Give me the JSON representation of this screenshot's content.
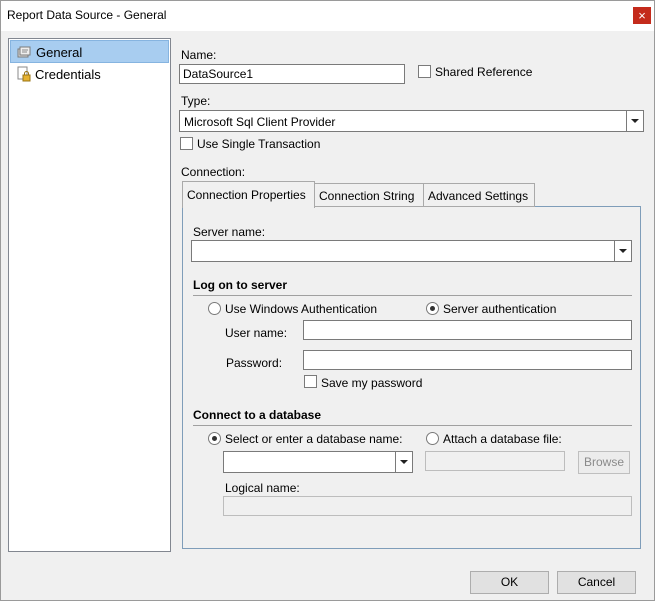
{
  "window": {
    "title": "Report Data Source - General",
    "close_glyph": "×"
  },
  "nav": {
    "items": [
      {
        "label": "General",
        "icon": "general-settings-icon",
        "selected": true
      },
      {
        "label": "Credentials",
        "icon": "credentials-lock-icon",
        "selected": false
      }
    ]
  },
  "general": {
    "name_label": "Name:",
    "name_value": "DataSource1",
    "shared_reference_label": "Shared Reference",
    "shared_reference_checked": false,
    "type_label": "Type:",
    "type_value": "Microsoft Sql Client Provider",
    "single_transaction_label": "Use Single Transaction",
    "single_transaction_checked": false,
    "connection_label": "Connection:"
  },
  "tabs": [
    {
      "label": "Connection Properties",
      "active": true
    },
    {
      "label": "Connection String",
      "active": false
    },
    {
      "label": "Advanced Settings",
      "active": false
    }
  ],
  "connection": {
    "server_name_label": "Server name:",
    "server_name_value": "",
    "logon_title": "Log on to server",
    "windows_auth_label": "Use Windows Authentication",
    "server_auth_label": "Server authentication",
    "auth_mode": "server",
    "username_label": "User name:",
    "username_value": "",
    "password_label": "Password:",
    "password_value": "",
    "save_password_label": "Save my password",
    "save_password_checked": false,
    "database_title": "Connect to a database",
    "select_db_label": "Select or enter a database name:",
    "attach_db_label": "Attach a database file:",
    "db_mode": "select",
    "database_value": "",
    "attach_file_value": "",
    "browse_label": "Browse",
    "logical_name_label": "Logical name:",
    "logical_name_value": ""
  },
  "buttons": {
    "ok_label": "OK",
    "cancel_label": "Cancel"
  }
}
